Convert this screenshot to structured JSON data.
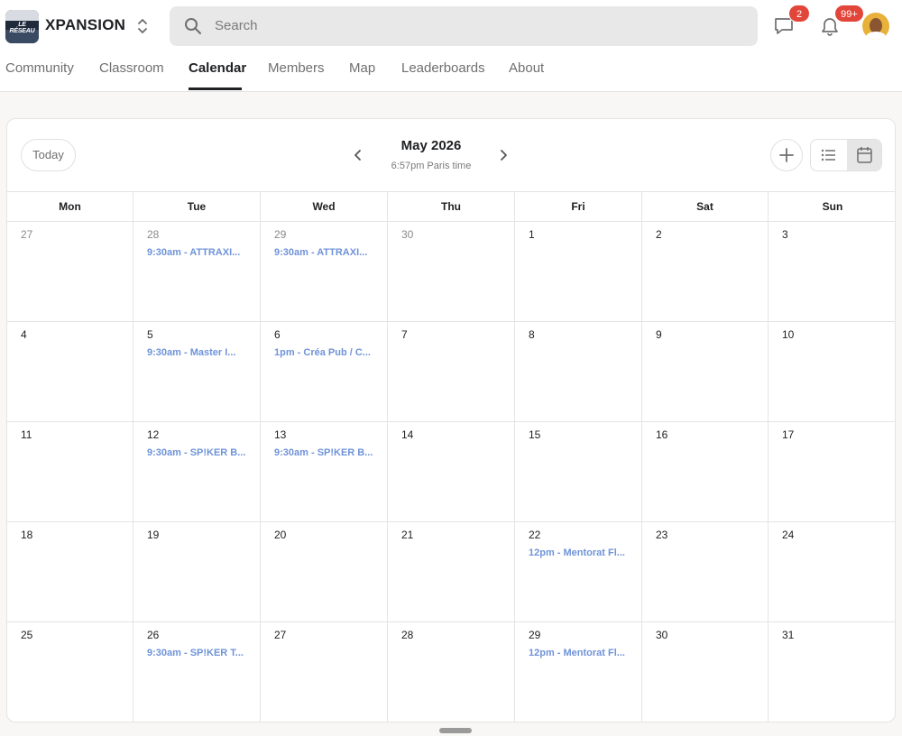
{
  "header": {
    "logo_text": "LE RÉSEAU",
    "brand": "XPANSION",
    "search_placeholder": "Search",
    "chat_badge": "2",
    "notif_badge": "99+"
  },
  "nav": {
    "tabs": [
      "Community",
      "Classroom",
      "Calendar",
      "Members",
      "Map",
      "Leaderboards",
      "About"
    ],
    "active": "Calendar"
  },
  "calendar": {
    "today_label": "Today",
    "month_title": "May 2026",
    "timezone": "6:57pm Paris time",
    "days_of_week": [
      "Mon",
      "Tue",
      "Wed",
      "Thu",
      "Fri",
      "Sat",
      "Sun"
    ],
    "weeks": [
      [
        {
          "day": "27",
          "other": true,
          "event": ""
        },
        {
          "day": "28",
          "other": true,
          "event": "9:30am - ATTRAXI..."
        },
        {
          "day": "29",
          "other": true,
          "event": "9:30am - ATTRAXI..."
        },
        {
          "day": "30",
          "other": true,
          "event": ""
        },
        {
          "day": "1",
          "other": false,
          "event": ""
        },
        {
          "day": "2",
          "other": false,
          "event": ""
        },
        {
          "day": "3",
          "other": false,
          "event": ""
        }
      ],
      [
        {
          "day": "4",
          "other": false,
          "event": ""
        },
        {
          "day": "5",
          "other": false,
          "event": "9:30am - Master I..."
        },
        {
          "day": "6",
          "other": false,
          "event": "1pm - Créa Pub / C..."
        },
        {
          "day": "7",
          "other": false,
          "event": ""
        },
        {
          "day": "8",
          "other": false,
          "event": ""
        },
        {
          "day": "9",
          "other": false,
          "event": ""
        },
        {
          "day": "10",
          "other": false,
          "event": ""
        }
      ],
      [
        {
          "day": "11",
          "other": false,
          "event": ""
        },
        {
          "day": "12",
          "other": false,
          "event": "9:30am - SP!KER B..."
        },
        {
          "day": "13",
          "other": false,
          "event": "9:30am - SP!KER B..."
        },
        {
          "day": "14",
          "other": false,
          "event": ""
        },
        {
          "day": "15",
          "other": false,
          "event": ""
        },
        {
          "day": "16",
          "other": false,
          "event": ""
        },
        {
          "day": "17",
          "other": false,
          "event": ""
        }
      ],
      [
        {
          "day": "18",
          "other": false,
          "event": ""
        },
        {
          "day": "19",
          "other": false,
          "event": ""
        },
        {
          "day": "20",
          "other": false,
          "event": ""
        },
        {
          "day": "21",
          "other": false,
          "event": ""
        },
        {
          "day": "22",
          "other": false,
          "event": "12pm - Mentorat Fl..."
        },
        {
          "day": "23",
          "other": false,
          "event": ""
        },
        {
          "day": "24",
          "other": false,
          "event": ""
        }
      ],
      [
        {
          "day": "25",
          "other": false,
          "event": ""
        },
        {
          "day": "26",
          "other": false,
          "event": "9:30am - SP!KER T..."
        },
        {
          "day": "27",
          "other": false,
          "event": ""
        },
        {
          "day": "28",
          "other": false,
          "event": ""
        },
        {
          "day": "29",
          "other": false,
          "event": "12pm - Mentorat Fl..."
        },
        {
          "day": "30",
          "other": false,
          "event": ""
        },
        {
          "day": "31",
          "other": false,
          "event": ""
        }
      ]
    ]
  },
  "colors": {
    "event_text": "#6f93d9",
    "badge": "#e2463a",
    "active_tab": "#202124"
  },
  "icons": [
    "switcher-icon",
    "search-icon",
    "chat-icon",
    "bell-icon",
    "chevron-left-icon",
    "chevron-right-icon",
    "plus-icon",
    "list-icon",
    "calendar-icon"
  ]
}
